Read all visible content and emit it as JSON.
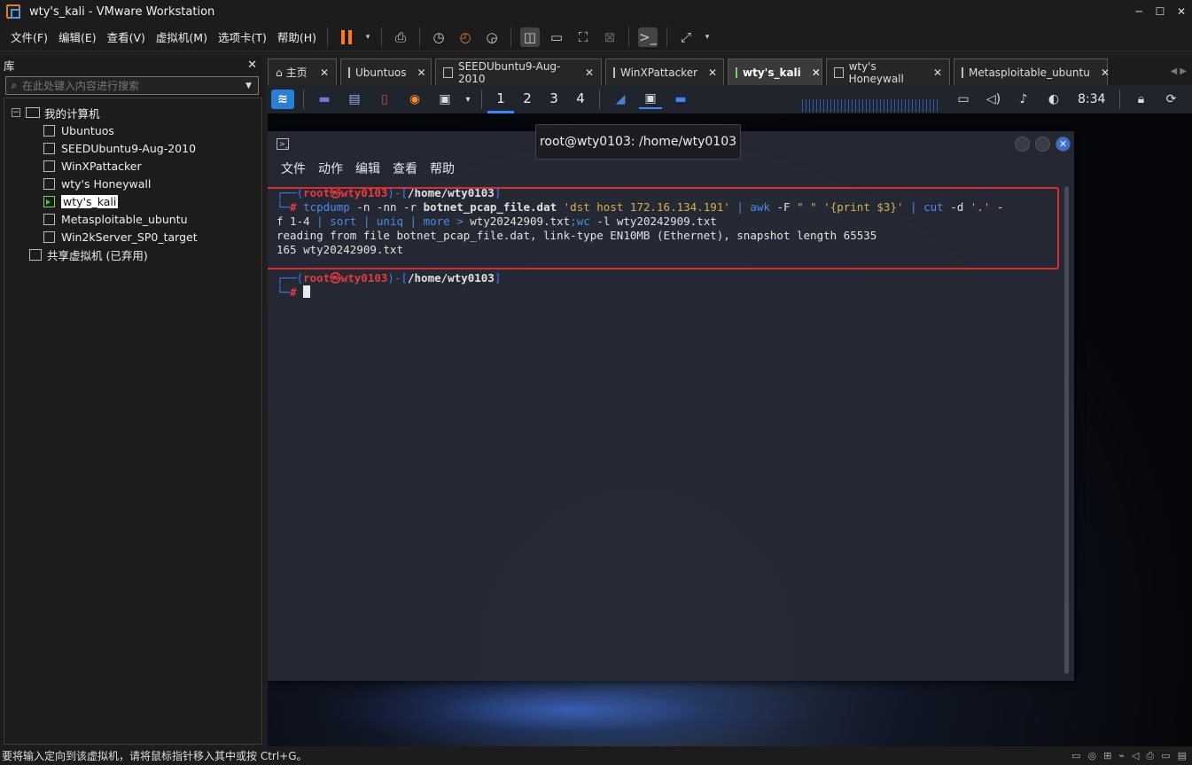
{
  "window": {
    "title": "wty's_kali - VMware Workstation",
    "min": "─",
    "max": "☐",
    "close": "✕"
  },
  "menus": [
    "文件(F)",
    "编辑(E)",
    "查看(V)",
    "虚拟机(M)",
    "选项卡(T)",
    "帮助(H)"
  ],
  "library": {
    "title": "库",
    "close": "✕",
    "search_placeholder": "在此处键入内容进行搜索",
    "root": "我的计算机",
    "vms": [
      "Ubuntuos",
      "SEEDUbuntu9-Aug-2010",
      "WinXPattacker",
      "wty's Honeywall",
      "wty's_kali",
      "Metasploitable_ubuntu",
      "Win2kServer_SP0_target"
    ],
    "selected_vm": "wty's_kali",
    "shared": "共享虚拟机 (已弃用)"
  },
  "tabs": [
    {
      "label": "主页",
      "active": false
    },
    {
      "label": "Ubuntuos",
      "active": false
    },
    {
      "label": "SEEDUbuntu9-Aug-2010",
      "active": false
    },
    {
      "label": "WinXPattacker",
      "active": false
    },
    {
      "label": "wty's_kali",
      "active": true
    },
    {
      "label": "wty's Honeywall",
      "active": false
    },
    {
      "label": "Metasploitable_ubuntu",
      "active": false
    }
  ],
  "kali_panel": {
    "workspaces": [
      "1",
      "2",
      "3",
      "4"
    ],
    "clock": "8:34"
  },
  "tooltip": "root@wty0103: /home/wty0103",
  "terminal": {
    "menu": [
      "文件",
      "动作",
      "编辑",
      "查看",
      "帮助"
    ],
    "prompt_user": "root",
    "prompt_at": "㉿",
    "prompt_host": "wty0103",
    "prompt_path": "/home/wty0103",
    "cmd_a1": "tcpdump",
    "cmd_a2": " -n -nn -r ",
    "cmd_a3": "botnet_pcap_file.dat",
    "cmd_a4": "'dst host 172.16.134.191'",
    "cmd_a5": " | ",
    "cmd_a6": "awk",
    "cmd_a7": " -F ",
    "cmd_a8": "\" \" '{print $3}'",
    "cmd_a9": " | ",
    "cmd_a10": "cut",
    "cmd_a11": " -d ",
    "cmd_a12": "'.'",
    "cmd_a13": " -",
    "cmd_b1": "f 1-4 ",
    "cmd_b2": "| ",
    "cmd_b3": "sort",
    "cmd_b4": " | ",
    "cmd_b5": "uniq",
    "cmd_b6": " | ",
    "cmd_b7": "more",
    "cmd_b8": " > ",
    "cmd_b9": "wty20242909.txt",
    "cmd_b10": ";",
    "cmd_b11": "wc",
    "cmd_b12": " -l ",
    "cmd_b13": "wty20242909.txt",
    "out1": "reading from file botnet_pcap_file.dat, link-type EN10MB (Ethernet), snapshot length 65535",
    "out2": "165 wty20242909.txt"
  },
  "status": "要将输入定向到该虚拟机，请将鼠标指针移入其中或按 Ctrl+G。"
}
